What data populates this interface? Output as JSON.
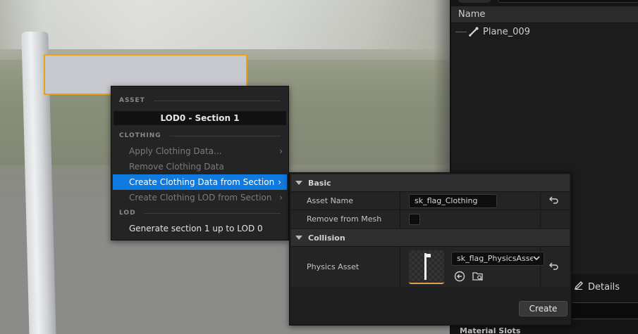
{
  "outliner": {
    "column_header": "Name",
    "items": [
      {
        "label": "Plane_009",
        "icon": "bone-icon"
      }
    ],
    "details_tab": "Details",
    "material_slots_label": "Material Slots"
  },
  "context_menu": {
    "section_asset": "ASSET",
    "asset_title": "LOD0 - Section 1",
    "section_clothing": "CLOTHING",
    "items": [
      {
        "label": "Apply Clothing Data...",
        "enabled": false,
        "submenu": true
      },
      {
        "label": "Remove Clothing Data",
        "enabled": false,
        "submenu": false
      },
      {
        "label": "Create Clothing Data from Section",
        "enabled": true,
        "submenu": true,
        "active": true
      },
      {
        "label": "Create Clothing LOD from Section",
        "enabled": false,
        "submenu": true
      }
    ],
    "section_lod": "LOD",
    "lod_item": "Generate section 1 up to LOD 0"
  },
  "create_panel": {
    "category_basic": "Basic",
    "asset_name_label": "Asset Name",
    "asset_name_value": "sk_flag_Clothing",
    "remove_from_mesh_label": "Remove from Mesh",
    "remove_from_mesh_checked": false,
    "category_collision": "Collision",
    "physics_asset_label": "Physics Asset",
    "physics_asset_value": "sk_flag_PhysicsAsset",
    "create_button": "Create"
  },
  "colors": {
    "selection_accent": "#0f7adf",
    "selection_outline": "#e8a218"
  }
}
